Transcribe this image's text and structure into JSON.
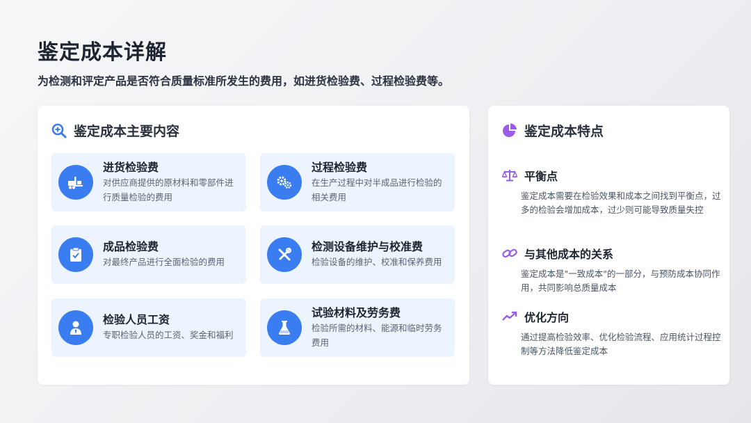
{
  "header": {
    "title": "鉴定成本详解",
    "subtitle": "为检测和评定产品是否符合质量标准所发生的费用，如进货检验费、过程检验费等。"
  },
  "left_card": {
    "title": "鉴定成本主要内容",
    "icon": "search-plus-icon",
    "items": [
      {
        "title": "进货检验费",
        "desc": "对供应商提供的原材料和零部件进行质量检验的费用",
        "icon": "forklift-icon"
      },
      {
        "title": "过程检验费",
        "desc": "在生产过程中对半成品进行检验的相关费用",
        "icon": "gears-icon"
      },
      {
        "title": "成品检验费",
        "desc": "对最终产品进行全面检验的费用",
        "icon": "clipboard-check-icon"
      },
      {
        "title": "检测设备维护与校准费",
        "desc": "检验设备的维护、校准和保养费用",
        "icon": "tools-icon"
      },
      {
        "title": "检验人员工资",
        "desc": "专职检验人员的工资、奖金和福利",
        "icon": "user-tie-icon"
      },
      {
        "title": "试验材料及劳务费",
        "desc": "检验所需的材料、能源和临时劳务费用",
        "icon": "flask-icon"
      }
    ]
  },
  "right_card": {
    "title": "鉴定成本特点",
    "icon": "pie-chart-icon",
    "features": [
      {
        "title": "平衡点",
        "desc": "鉴定成本需要在检验效果和成本之间找到平衡点，过多的检验会增加成本，过少则可能导致质量失控",
        "icon": "scale-icon"
      },
      {
        "title": "与其他成本的关系",
        "desc": "鉴定成本是\"一致成本\"的一部分，与预防成本协同作用，共同影响总质量成本",
        "icon": "link-icon"
      },
      {
        "title": "优化方向",
        "desc": "通过提高检验效率、优化检验流程、应用统计过程控制等方法降低鉴定成本",
        "icon": "trend-up-icon"
      }
    ]
  },
  "colors": {
    "accent_blue": "#3a7df0",
    "accent_purple": "#9b5de5",
    "item_bg": "#eef4fe"
  }
}
